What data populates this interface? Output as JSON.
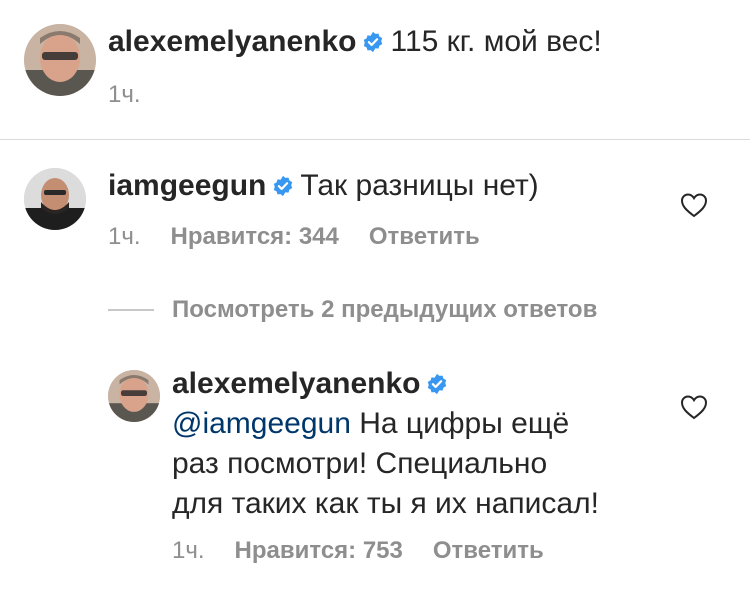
{
  "post": {
    "username": "alexemelyanenko",
    "verified": true,
    "text": "115 кг. мой вес!",
    "time": "1ч."
  },
  "comment": {
    "username": "iamgeegun",
    "verified": true,
    "text": "Так разницы нет)",
    "time": "1ч.",
    "likes_label": "Нравится: 344",
    "reply_label": "Ответить"
  },
  "view_replies_label": "Посмотреть 2 предыдущих ответов",
  "reply": {
    "username": "alexemelyanenko",
    "verified": true,
    "mention": "@iamgeegun",
    "text_line1": "На цифры ещё",
    "text_line2": "раз посмотри! Специально",
    "text_line3": "для таких как ты я их написал!",
    "time": "1ч.",
    "likes_label": "Нравится: 753",
    "reply_label": "Ответить"
  },
  "icons": {
    "verified": "verified-badge-icon",
    "like": "heart-icon"
  },
  "colors": {
    "verified_blue": "#3897f0",
    "mention": "#00376b",
    "meta_gray": "#8e8e8e",
    "divider": "#dbdbdb"
  }
}
